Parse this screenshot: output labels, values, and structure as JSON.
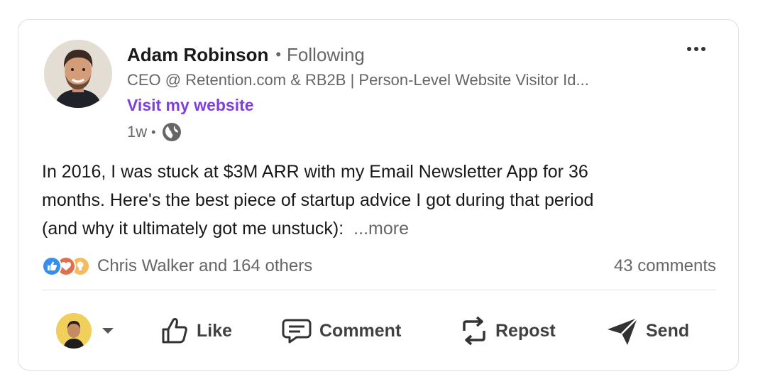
{
  "post": {
    "author": {
      "name": "Adam Robinson",
      "separator": "•",
      "follow_status": "Following",
      "headline": "CEO @ Retention.com & RB2B | Person-Level Website Visitor Id...",
      "website_link": "Visit my website",
      "timestamp": "1w",
      "visibility_icon": "globe-icon"
    },
    "menu_icon": "more-horizontal-icon",
    "body": {
      "lines": [
        "In 2016, I was stuck at $3M ARR with my Email Newsletter App for 36",
        "months. Here's the best piece of startup advice I got during that period",
        "(and why it ultimately got me unstuck):"
      ],
      "see_more": "...more"
    },
    "social": {
      "reaction_icons": [
        "like-icon",
        "love-icon",
        "insightful-icon"
      ],
      "reactions_text": "Chris Walker and 164 others",
      "comments_text": "43 comments"
    },
    "actions": {
      "like": "Like",
      "comment": "Comment",
      "repost": "Repost",
      "send": "Send"
    },
    "colors": {
      "link_purple": "#7f3fe0",
      "muted_text": "#666666",
      "like_blue": "#378fe9",
      "love_orange": "#df704d",
      "insight_yellow": "#f5bb5c"
    }
  }
}
